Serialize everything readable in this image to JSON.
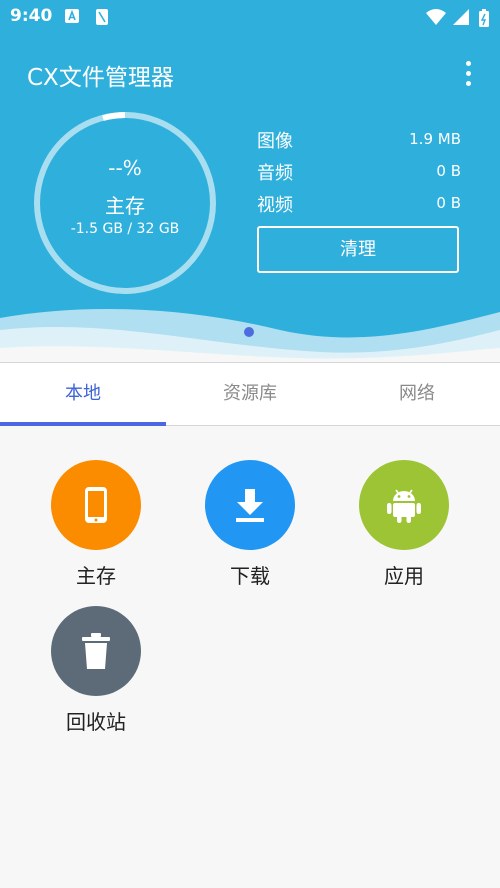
{
  "status_bar": {
    "time": "9:40"
  },
  "header": {
    "title": "CX文件管理器"
  },
  "storage": {
    "percent": "--%",
    "label": "主存",
    "usage": "-1.5 GB / 32 GB"
  },
  "stats": [
    {
      "label": "图像",
      "value": "1.9 MB"
    },
    {
      "label": "音频",
      "value": "0 B"
    },
    {
      "label": "视频",
      "value": "0 B"
    }
  ],
  "clean_button": "清理",
  "tabs": [
    {
      "label": "本地",
      "active": true
    },
    {
      "label": "资源库",
      "active": false
    },
    {
      "label": "网络",
      "active": false
    }
  ],
  "grid": [
    {
      "label": "主存",
      "icon": "phone-icon",
      "color": "#fb8c00"
    },
    {
      "label": "下载",
      "icon": "download-icon",
      "color": "#2196f3"
    },
    {
      "label": "应用",
      "icon": "android-icon",
      "color": "#9dc434"
    },
    {
      "label": "回收站",
      "icon": "trash-icon",
      "color": "#5d6b78"
    }
  ],
  "colors": {
    "header_bg": "#2fb0dc",
    "tab_active": "#3d63d8",
    "tab_indicator": "#4d67e2",
    "background": "#f7f7f7"
  }
}
